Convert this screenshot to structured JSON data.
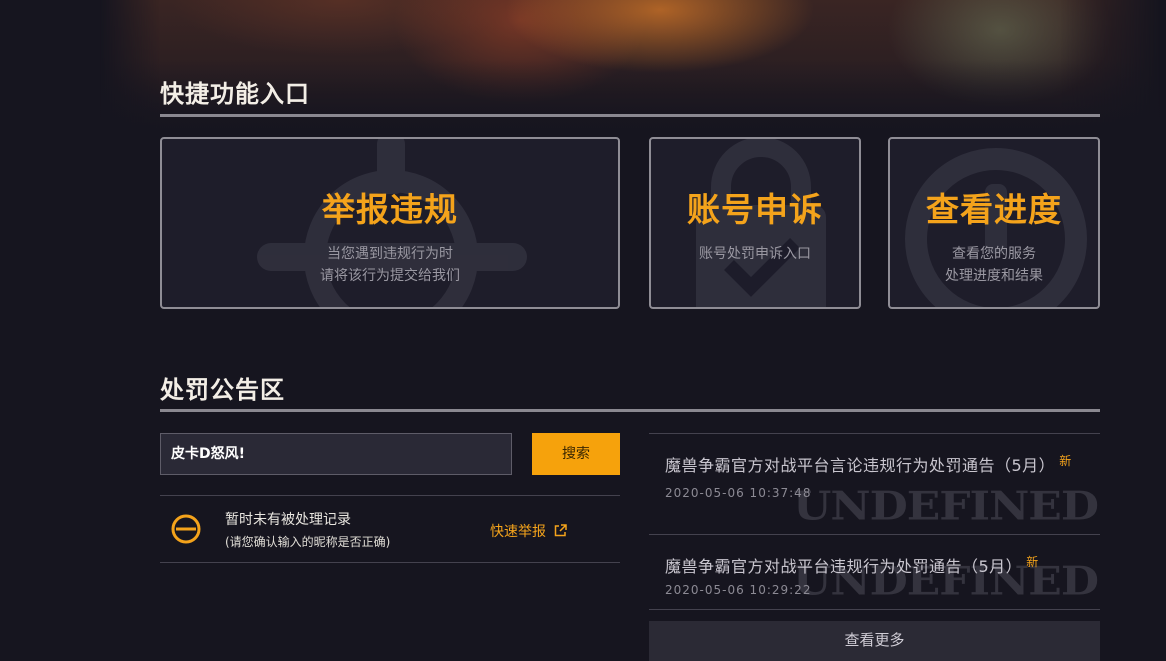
{
  "quick_entry": {
    "title": "快捷功能入口",
    "cards": [
      {
        "title": "举报违规",
        "desc_line1": "当您遇到违规行为时",
        "desc_line2": "请将该行为提交给我们",
        "icon": "crosshair-icon"
      },
      {
        "title": "账号申诉",
        "desc_line1": "账号处罚申诉入口",
        "icon": "padlock-check-icon"
      },
      {
        "title": "查看进度",
        "desc_line1": "查看您的服务",
        "desc_line2": "处理进度和结果",
        "icon": "clock-icon"
      }
    ]
  },
  "punishment": {
    "title": "处罚公告区",
    "search": {
      "value": "皮卡D怒风!",
      "button_label": "搜索"
    },
    "result": {
      "main": "暂时未有被处理记录",
      "sub": "(请您确认输入的昵称是否正确)",
      "quick_report_label": "快速举报",
      "icon": "no-entry-icon"
    },
    "notices": [
      {
        "title": "魔兽争霸官方对战平台言论违规行为处罚通告（5月）",
        "badge": "新",
        "date": "2020-05-06 10:37:48",
        "watermark": "UNDEFINED"
      },
      {
        "title": "魔兽争霸官方对战平台违规行为处罚通告（5月）",
        "badge": "新",
        "date": "2020-05-06 10:29:22",
        "watermark": "UNDEFINED"
      }
    ],
    "more_label": "查看更多"
  },
  "colors": {
    "accent": "#f4a31b",
    "button": "#f6a20c",
    "background": "#16151f",
    "card_border": "#8f8d95"
  }
}
